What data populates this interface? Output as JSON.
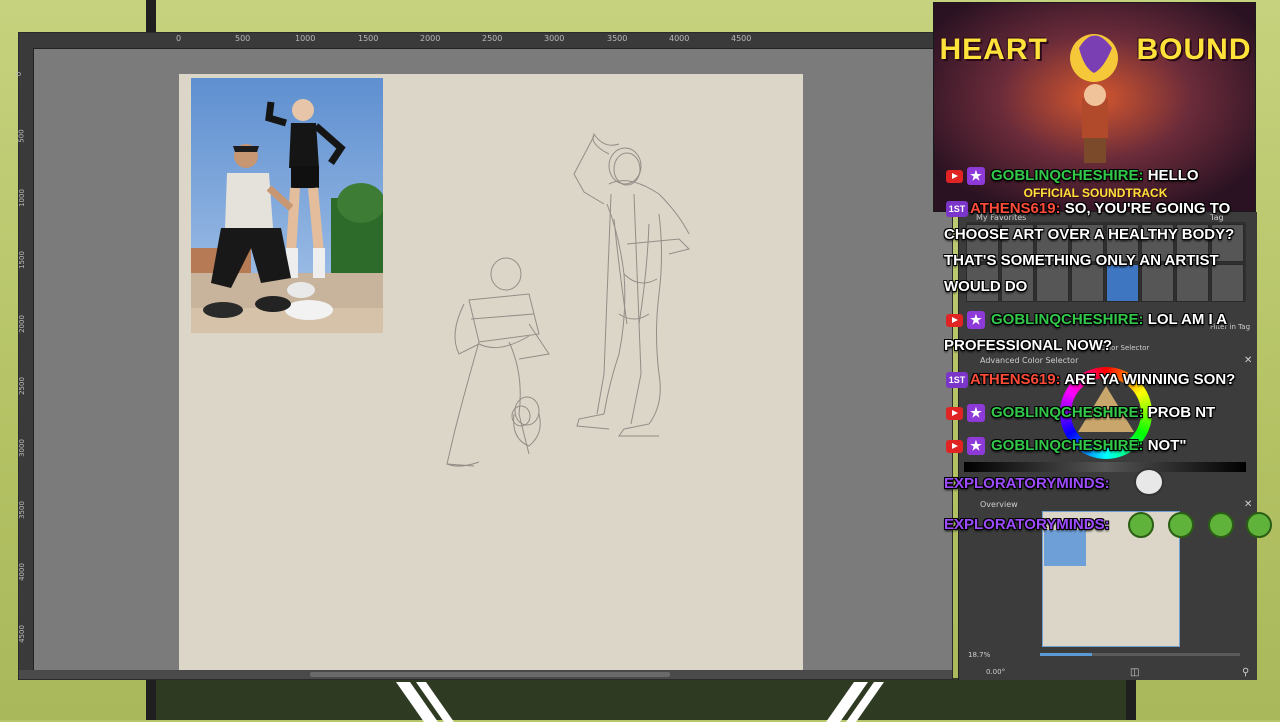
{
  "overlay": {
    "ad": {
      "title_left": "HEART",
      "title_right": "BOUND",
      "subtitle": "OFFICIAL SOUNDTRACK"
    }
  },
  "krita": {
    "ruler_top_labels": [
      "0",
      "500",
      "1000",
      "1500",
      "2000",
      "2500",
      "3000",
      "3500",
      "4000",
      "4500"
    ],
    "ruler_left_labels": [
      "0",
      "500",
      "1000",
      "1500",
      "2000",
      "2500",
      "3000",
      "3500",
      "4000",
      "4500"
    ],
    "dockers": {
      "favorites_title": "My Favorites",
      "tag_label": "Tag",
      "filter_label": "Filter in Tag",
      "color_selector_title": "Advanced Color Selector",
      "color_selector_tab": "Color Selector",
      "overview_title": "Overview",
      "zoom_value": "18.7%",
      "rotation_value": "0.00°"
    }
  },
  "chat": {
    "messages": [
      {
        "user": "GOBLINQCHESHIRE:",
        "user_color": "green",
        "badge": "mod-star",
        "text": "HELLO"
      },
      {
        "user": "ATHENS619:",
        "user_color": "red",
        "badge": "first",
        "text": "SO, YOU'RE GOING TO",
        "continuation": [
          "CHOOSE ART OVER A HEALTHY BODY?",
          "THAT'S SOMETHING ONLY AN ARTIST",
          "WOULD DO"
        ]
      },
      {
        "user": "GOBLINQCHESHIRE:",
        "user_color": "green",
        "badge": "mod-star",
        "text": "LOL AM I A",
        "continuation": [
          "PROFESSIONAL NOW?"
        ]
      },
      {
        "user": "ATHENS619:",
        "user_color": "red",
        "badge": "first",
        "text": "ARE YA WINNING SON?"
      },
      {
        "user": "GOBLINQCHESHIRE:",
        "user_color": "green",
        "badge": "mod-star",
        "text": "PROB NT"
      },
      {
        "user": "GOBLINQCHESHIRE:",
        "user_color": "green",
        "badge": "mod-star",
        "text": "NOT\""
      },
      {
        "user": "EXPLORATORYMINDS:",
        "user_color": "purple",
        "badge": "none",
        "text": ""
      },
      {
        "user": "EXPLORATORYMINDS:",
        "user_color": "purple",
        "badge": "none",
        "text": ""
      }
    ]
  },
  "colors": {
    "accent_green": "#32c94a",
    "accent_red": "#ff4b3a",
    "accent_purple": "#9d4bff",
    "ad_yellow": "#ffe23a",
    "canvas_paper": "#dcd6c8"
  }
}
